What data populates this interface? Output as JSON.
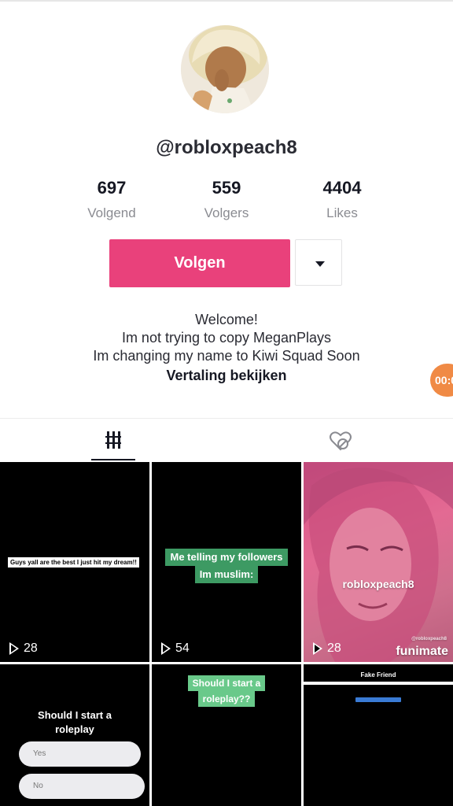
{
  "profile": {
    "username": "@robloxpeach8",
    "stats": [
      {
        "value": "697",
        "label": "Volgend"
      },
      {
        "value": "559",
        "label": "Volgers"
      },
      {
        "value": "4404",
        "label": "Likes"
      }
    ],
    "follow_label": "Volgen",
    "bio_lines": [
      "Welcome!",
      "Im not trying to copy MeganPlays",
      "Im changing my name to Kiwi Squad Soon"
    ],
    "translate_label": "Vertaling bekijken",
    "timer_text": "00:0"
  },
  "tabs": {
    "videos_icon": "grid-icon",
    "liked_icon": "hidden-heart-icon"
  },
  "videos": [
    {
      "caption": "Guys yall are the best I just hit my dream!!",
      "plays": "28"
    },
    {
      "caption_lines": [
        "Me telling my followers",
        "Im muslim:"
      ],
      "plays": "54"
    },
    {
      "caption": "robloxpeach8",
      "watermark": "funimate",
      "watermark_small": "@robloxpeach8",
      "plays": "28"
    },
    {
      "title_lines": [
        "Should I start a",
        "roleplay"
      ],
      "options": [
        "Yes",
        "No"
      ]
    },
    {
      "caption_lines": [
        "Should I start a",
        "roleplay??"
      ]
    },
    {
      "top_caption": "Fake Friend"
    }
  ],
  "colors": {
    "accent": "#e9417b",
    "timer": "#f08a45",
    "caption_green": "#3d9a63"
  }
}
